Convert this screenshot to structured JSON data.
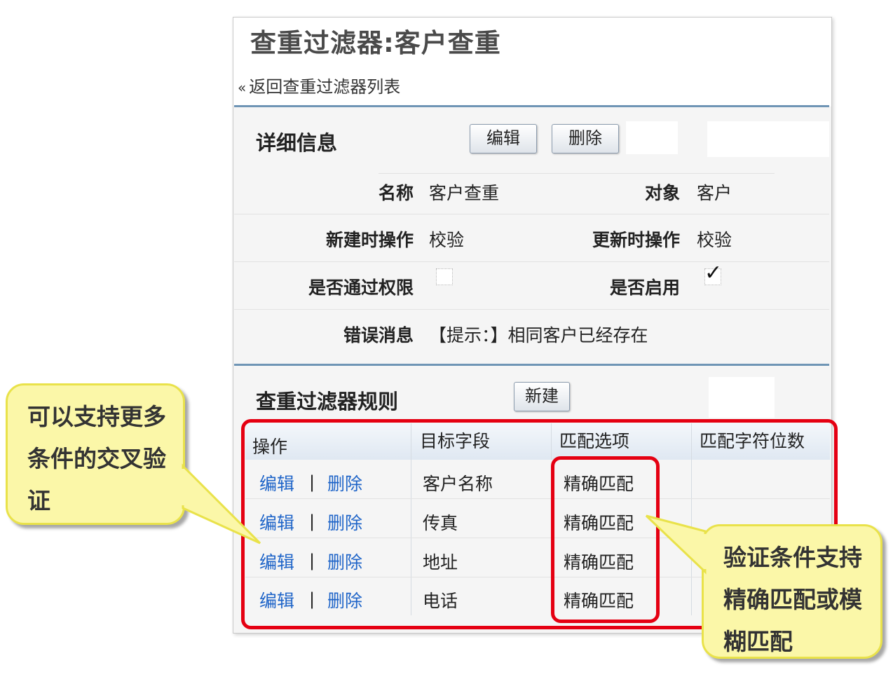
{
  "page": {
    "title": "查重过滤器:客户查重",
    "back_arrow": "«",
    "back_link": "返回查重过滤器列表"
  },
  "details": {
    "section_title": "详细信息",
    "edit_button": "编辑",
    "delete_button": "删除",
    "fields": {
      "name_label": "名称",
      "name_value": "客户查重",
      "object_label": "对象",
      "object_value": "客户",
      "on_create_label": "新建时操作",
      "on_create_value": "校验",
      "on_update_label": "更新时操作",
      "on_update_value": "校验",
      "bypass_permission_label": "是否通过权限",
      "bypass_permission_checked": false,
      "enabled_label": "是否启用",
      "enabled_checked": true,
      "enabled_mark": "✓",
      "error_label": "错误消息",
      "error_value": "【提示：】相同客户已经存在"
    }
  },
  "rules": {
    "section_title": "查重过滤器规则",
    "new_button": "新建",
    "columns": [
      "操作",
      "目标字段",
      "匹配选项",
      "匹配字符位数"
    ],
    "action_edit": "编辑",
    "action_separator": "|",
    "action_delete": "删除",
    "rows": [
      {
        "field": "客户名称",
        "match": "精确匹配",
        "chars": ""
      },
      {
        "field": "传真",
        "match": "精确匹配",
        "chars": ""
      },
      {
        "field": "地址",
        "match": "精确匹配",
        "chars": ""
      },
      {
        "field": "电话",
        "match": "精确匹配",
        "chars": ""
      }
    ]
  },
  "callouts": {
    "left": [
      "可以支持更多",
      "条件的交叉验",
      "证"
    ],
    "right": [
      "验证条件支持",
      "精确匹配或模",
      "糊匹配"
    ]
  },
  "colors": {
    "highlight_red": "#e50012",
    "callout_fill": "#fbf7a8",
    "link_blue": "#1e64c8",
    "separator_blue": "#6f95b5"
  }
}
